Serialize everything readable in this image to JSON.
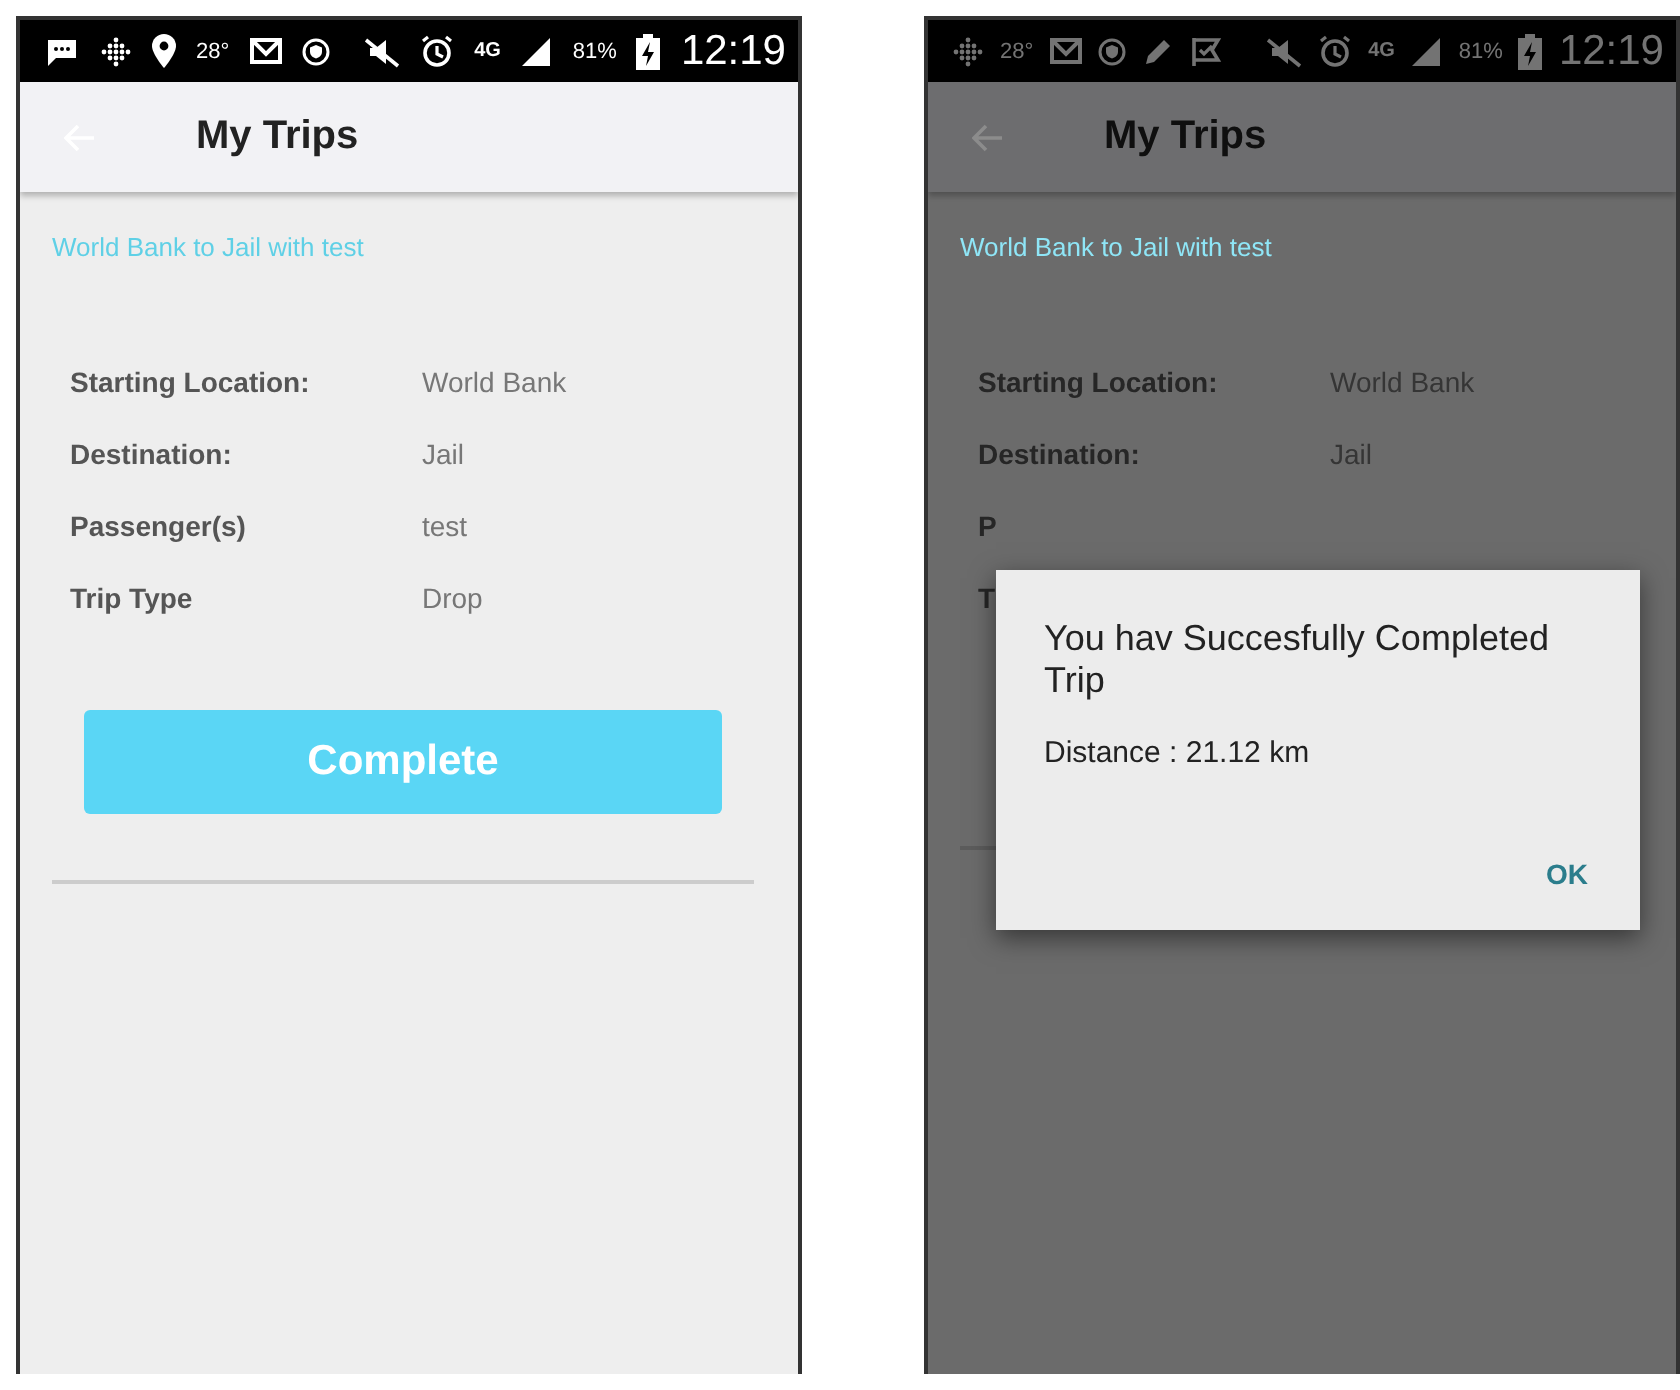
{
  "screens": [
    {
      "dimmed": false,
      "status_bar": {
        "left_items": [
          {
            "kind": "chat"
          },
          {
            "kind": "dots"
          },
          {
            "kind": "pin"
          },
          {
            "kind": "text",
            "text": "28°"
          },
          {
            "kind": "mail"
          },
          {
            "kind": "shield"
          }
        ],
        "right_items": [
          {
            "kind": "mute"
          },
          {
            "kind": "alarm"
          },
          {
            "kind": "network",
            "text": "4G"
          },
          {
            "kind": "signal"
          },
          {
            "kind": "text",
            "text": "81%"
          },
          {
            "kind": "battery"
          },
          {
            "kind": "clock",
            "text": "12:19"
          }
        ]
      },
      "app_bar": {
        "title": "My Trips"
      },
      "trip_title": "World Bank to Jail with test",
      "details": [
        {
          "label": "Starting Location:",
          "value": "World Bank"
        },
        {
          "label": "Destination:",
          "value": "Jail"
        },
        {
          "label": "Passenger(s)",
          "value": "test"
        },
        {
          "label": "Trip Type",
          "value": "Drop"
        }
      ],
      "complete_button": "Complete"
    },
    {
      "dimmed": true,
      "status_bar": {
        "left_items": [
          {
            "kind": "dots"
          },
          {
            "kind": "text",
            "text": "28°"
          },
          {
            "kind": "mail"
          },
          {
            "kind": "shield"
          },
          {
            "kind": "pen"
          },
          {
            "kind": "flag"
          }
        ],
        "right_items": [
          {
            "kind": "mute"
          },
          {
            "kind": "alarm"
          },
          {
            "kind": "network",
            "text": "4G"
          },
          {
            "kind": "signal"
          },
          {
            "kind": "text",
            "text": "81%"
          },
          {
            "kind": "battery"
          },
          {
            "kind": "clock",
            "text": "12:19"
          }
        ]
      },
      "app_bar": {
        "title": "My Trips"
      },
      "trip_title": "World Bank to Jail with test",
      "details": [
        {
          "label": "Starting Location:",
          "value": "World Bank"
        },
        {
          "label": "Destination:",
          "value": "Jail"
        },
        {
          "label": "P"
        },
        {
          "label": "T"
        }
      ],
      "dialog": {
        "title": "You hav Succesfully Completed Trip",
        "message": "Distance : 21.12 km",
        "button": "OK"
      }
    }
  ]
}
